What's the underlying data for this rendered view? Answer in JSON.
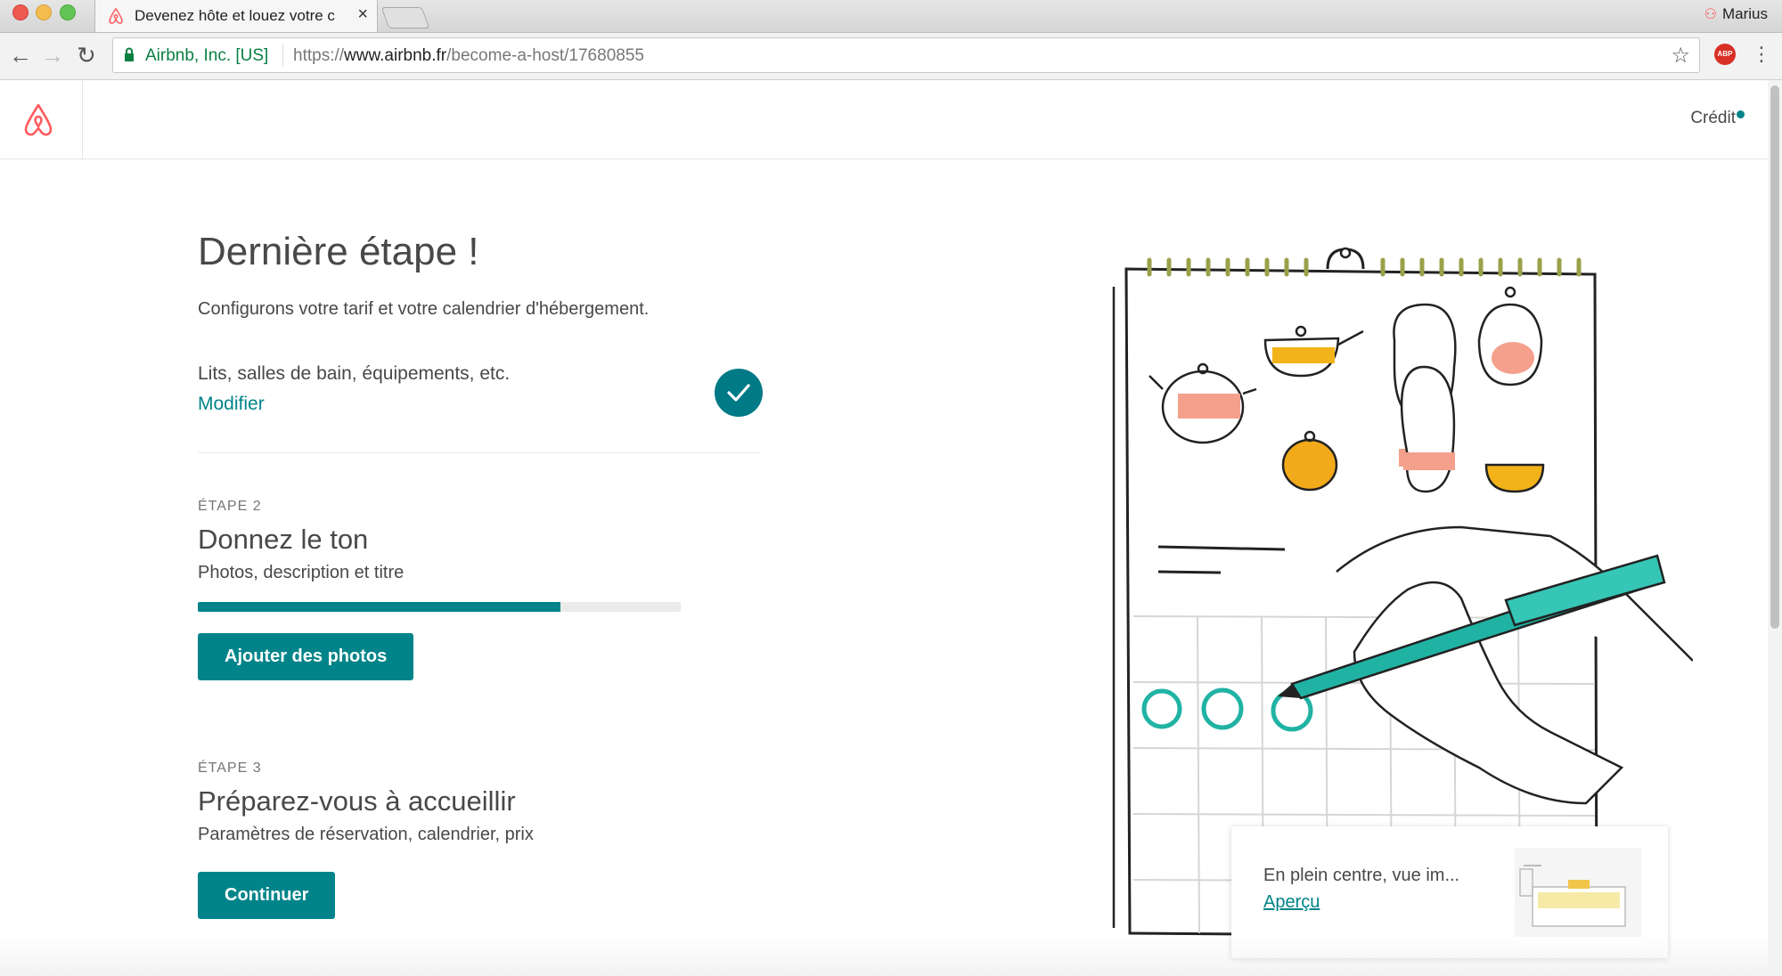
{
  "browser": {
    "tab_title": "Devenez hôte et louez votre c",
    "profile_name": "Marius",
    "org_label": "Airbnb, Inc. [US]",
    "url_prefix": "https://",
    "url_host": "www.airbnb.fr",
    "url_path": "/become-a-host/17680855",
    "extension_label": "ABP"
  },
  "header": {
    "credit_label": "Crédit"
  },
  "main": {
    "title": "Dernière étape !",
    "subtitle": "Configurons votre tarif et votre calendrier d'hébergement.",
    "step1": {
      "label": "Lits, salles de bain, équipements, etc.",
      "edit_label": "Modifier",
      "completed": true
    },
    "step2": {
      "kicker": "ÉTAPE 2",
      "title": "Donnez le ton",
      "description": "Photos, description et titre",
      "progress_fraction": 0.75,
      "button_label": "Ajouter des photos"
    },
    "step3": {
      "kicker": "ÉTAPE 3",
      "title": "Préparez-vous à accueillir",
      "description": "Paramètres de réservation, calendrier, prix",
      "button_label": "Continuer"
    }
  },
  "preview": {
    "title": "En plein centre, vue im...",
    "link_label": "Aperçu"
  },
  "colors": {
    "accent": "#008489",
    "brand": "#ff5a5f",
    "check": "#007a87"
  }
}
